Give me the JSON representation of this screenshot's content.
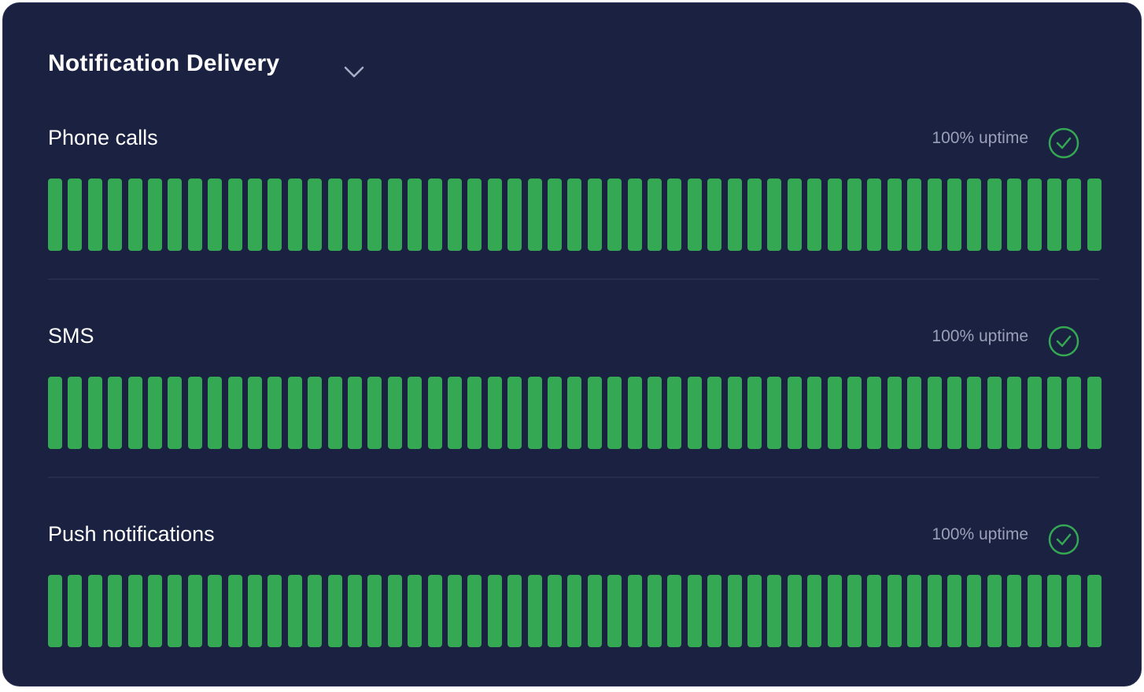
{
  "card": {
    "title": "Notification Delivery"
  },
  "colors": {
    "background": "#1b2140",
    "bar_up": "#34a853",
    "status_ok": "#34a853",
    "uptime_text": "#9aa0b8"
  },
  "sections": [
    {
      "label": "Phone calls",
      "uptime": "100% uptime",
      "status_icon": "check-circle-icon",
      "bar_count": 53,
      "status": "up"
    },
    {
      "label": "SMS",
      "uptime": "100% uptime",
      "status_icon": "check-circle-icon",
      "bar_count": 53,
      "status": "up"
    },
    {
      "label": "Push notifications",
      "uptime": "100% uptime",
      "status_icon": "check-circle-icon",
      "bar_count": 53,
      "status": "up"
    }
  ]
}
